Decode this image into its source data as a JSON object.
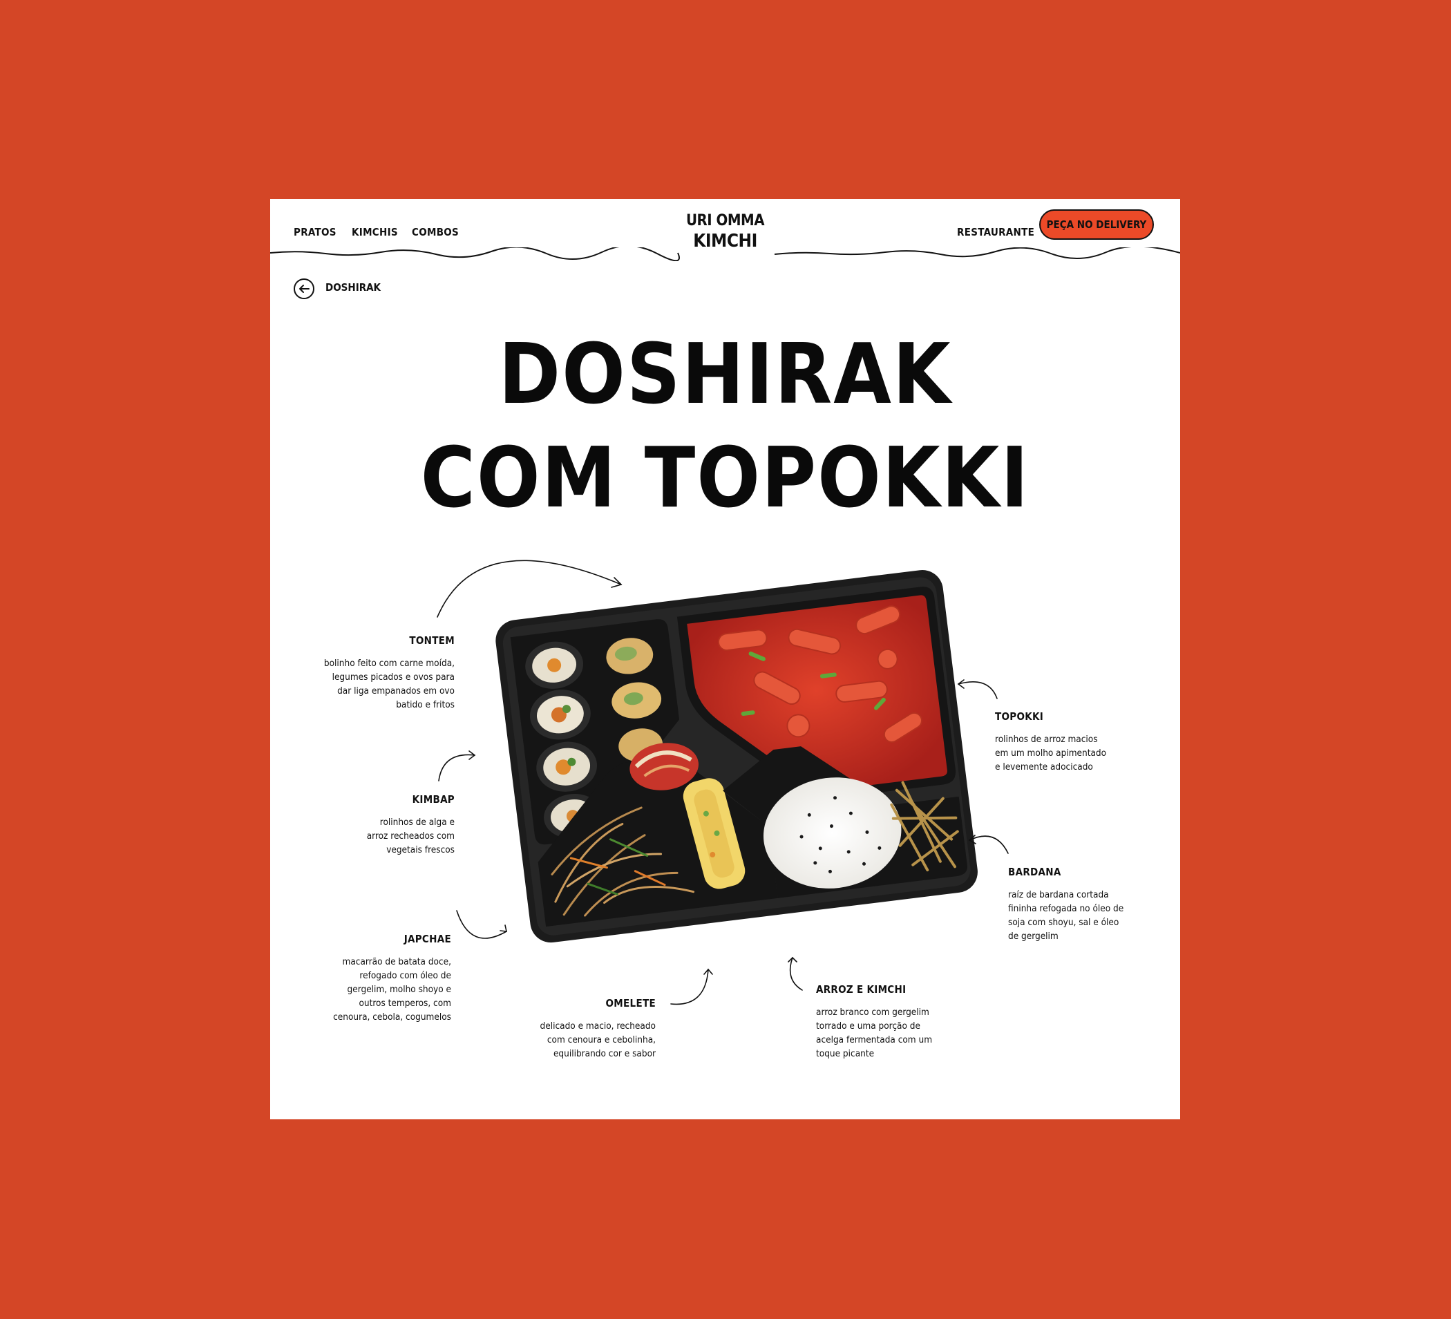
{
  "nav": {
    "links": [
      "PRATOS",
      "KIMCHIS",
      "COMBOS"
    ],
    "restaurant": "RESTAURANTE",
    "cta": "PEÇA NO DELIVERY"
  },
  "logo": {
    "line1": "URI OMMA",
    "line2": "KIMCHI"
  },
  "breadcrumb": "DOSHIRAK",
  "title": {
    "line1": "DOSHIRAK",
    "line2": "COM TOPOKKI"
  },
  "items": {
    "tontem": {
      "name": "TONTEM",
      "desc": "bolinho feito com carne moída,\nlegumes picados e ovos para\ndar liga empanados em ovo\nbatido e fritos"
    },
    "kimbap": {
      "name": "KIMBAP",
      "desc": "rolinhos de alga e\narroz recheados com\nvegetais frescos"
    },
    "japchae": {
      "name": "JAPCHAE",
      "desc": "macarrão de batata doce,\nrefogado com óleo de\ngergelim, molho shoyo e\noutros temperos, com\ncenoura, cebola, cogumelos"
    },
    "omelete": {
      "name": "OMELETE",
      "desc": "delicado e macio, recheado\ncom cenoura e cebolinha,\nequilibrando cor e sabor"
    },
    "arroz": {
      "name": "ARROZ E KIMCHI",
      "desc": "arroz branco com gergelim\ntorrado e uma porção de\nacelga fermentada com um\ntoque picante"
    },
    "topokki": {
      "name": "TOPOKKI",
      "desc": "rolinhos de arroz macios\nem um molho apimentado\ne levemente adocicado"
    },
    "bardana": {
      "name": "BARDANA",
      "desc": "raíz de bardana cortada\nfininha refogada no óleo de\nsoja com shoyu, sal e óleo\nde gergelim"
    }
  },
  "colors": {
    "background": "#d44626",
    "accent": "#ec4a28",
    "page": "#ffffff",
    "ink": "#111111"
  },
  "icons": {
    "back": "arrow-left-icon"
  }
}
